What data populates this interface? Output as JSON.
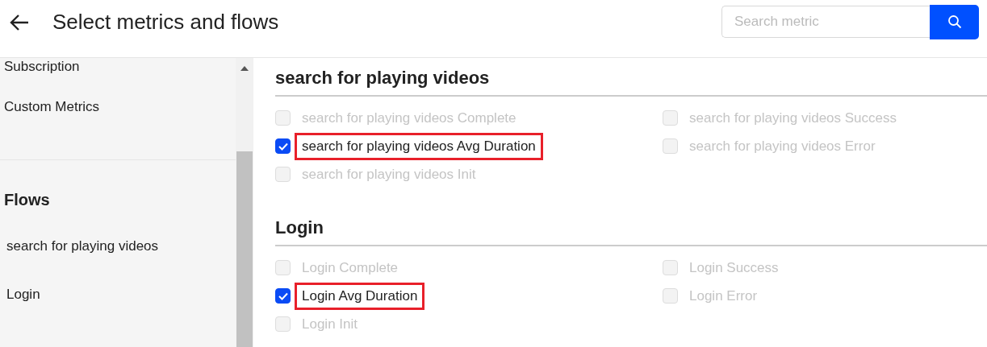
{
  "header": {
    "title": "Select metrics and flows",
    "search": {
      "placeholder": "Search metric"
    }
  },
  "sidebar": {
    "metrics_items": [
      "Subscription",
      "Custom Metrics"
    ],
    "flows_heading": "Flows",
    "flows": [
      "search for playing videos",
      "Login"
    ]
  },
  "sections": [
    {
      "title": "search for playing videos",
      "metrics": [
        {
          "label": "search for playing videos Complete",
          "checked": false,
          "disabled": true,
          "highlighted": false
        },
        {
          "label": "search for playing videos Success",
          "checked": false,
          "disabled": true,
          "highlighted": false
        },
        {
          "label": "search for playing videos Avg Duration",
          "checked": true,
          "disabled": false,
          "highlighted": true
        },
        {
          "label": "search for playing videos Error",
          "checked": false,
          "disabled": true,
          "highlighted": false
        },
        {
          "label": "search for playing videos Init",
          "checked": false,
          "disabled": true,
          "highlighted": false
        }
      ]
    },
    {
      "title": "Login",
      "metrics": [
        {
          "label": "Login Complete",
          "checked": false,
          "disabled": true,
          "highlighted": false
        },
        {
          "label": "Login Success",
          "checked": false,
          "disabled": true,
          "highlighted": false
        },
        {
          "label": "Login Avg Duration",
          "checked": true,
          "disabled": false,
          "highlighted": true
        },
        {
          "label": "Login Error",
          "checked": false,
          "disabled": true,
          "highlighted": false
        },
        {
          "label": "Login Init",
          "checked": false,
          "disabled": true,
          "highlighted": false
        }
      ]
    }
  ]
}
